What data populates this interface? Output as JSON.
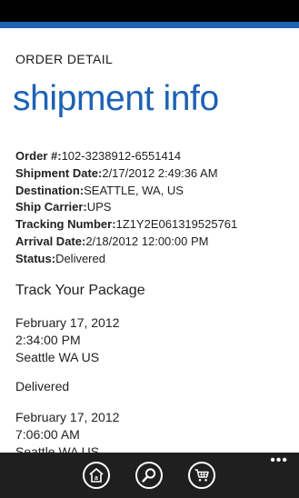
{
  "colors": {
    "accent": "#1d62b5",
    "text": "#222222",
    "app_bar": "#1f1f1f"
  },
  "header": {
    "app_title": "ORDER DETAIL",
    "page_title": "shipment info"
  },
  "details": [
    {
      "label": "Order #:",
      "value": "102-3238912-6551414"
    },
    {
      "label": "Shipment Date:",
      "value": "2/17/2012 2:49:36 AM"
    },
    {
      "label": "Destination:",
      "value": "SEATTLE, WA, US"
    },
    {
      "label": "Ship Carrier:",
      "value": "UPS"
    },
    {
      "label": "Tracking Number:",
      "value": "1Z1Y2E061319525761"
    },
    {
      "label": "Arrival Date:",
      "value": "2/18/2012 12:00:00 PM"
    },
    {
      "label": "Status:",
      "value": "Delivered"
    }
  ],
  "track": {
    "heading": "Track Your Package",
    "events": [
      {
        "date": "February 17, 2012",
        "time": "2:34:00 PM",
        "location": "Seattle WA US",
        "status": "Delivered"
      },
      {
        "date": "February 17, 2012",
        "time": "7:06:00 AM",
        "location": "Seattle WA US",
        "status": ""
      }
    ]
  },
  "app_bar": {
    "buttons": [
      {
        "icon": "amazon-home-icon"
      },
      {
        "icon": "search-icon"
      },
      {
        "icon": "cart-icon"
      }
    ],
    "more": "•••"
  }
}
